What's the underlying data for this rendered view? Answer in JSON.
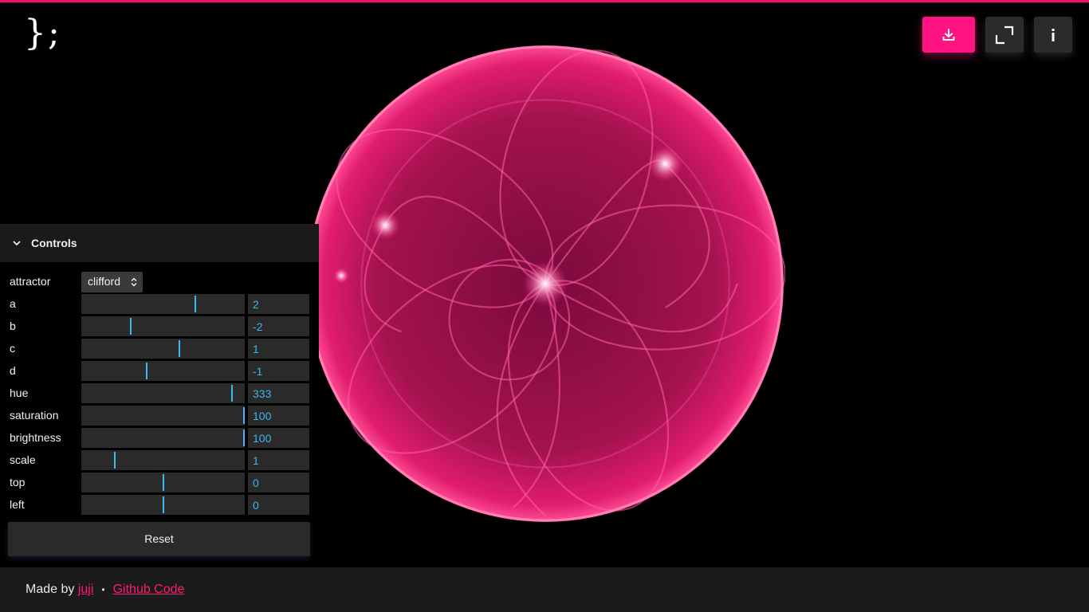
{
  "app": {
    "logo_text": "};",
    "accent": "#ff1281"
  },
  "toolbar": {
    "download_icon": "download-icon",
    "fullscreen_icon": "expand-icon",
    "info_icon": "info-icon"
  },
  "canvas": {
    "description_icon": "clifford-attractor-render"
  },
  "controls": {
    "title": "Controls",
    "attractor": {
      "label": "attractor",
      "value": "clifford"
    },
    "params": [
      {
        "label": "a",
        "value": "2",
        "fraction": 0.7
      },
      {
        "label": "b",
        "value": "-2",
        "fraction": 0.3
      },
      {
        "label": "c",
        "value": "1",
        "fraction": 0.6
      },
      {
        "label": "d",
        "value": "-1",
        "fraction": 0.4
      },
      {
        "label": "hue",
        "value": "333",
        "fraction": 0.925
      },
      {
        "label": "saturation",
        "value": "100",
        "fraction": 1.0
      },
      {
        "label": "brightness",
        "value": "100",
        "fraction": 1.0
      },
      {
        "label": "scale",
        "value": "1",
        "fraction": 0.2
      },
      {
        "label": "top",
        "value": "0",
        "fraction": 0.5
      },
      {
        "label": "left",
        "value": "0",
        "fraction": 0.5
      }
    ],
    "reset_label": "Reset"
  },
  "footer": {
    "made_by": "Made by",
    "author": "juji",
    "separator": "•",
    "github": "Github Code"
  }
}
